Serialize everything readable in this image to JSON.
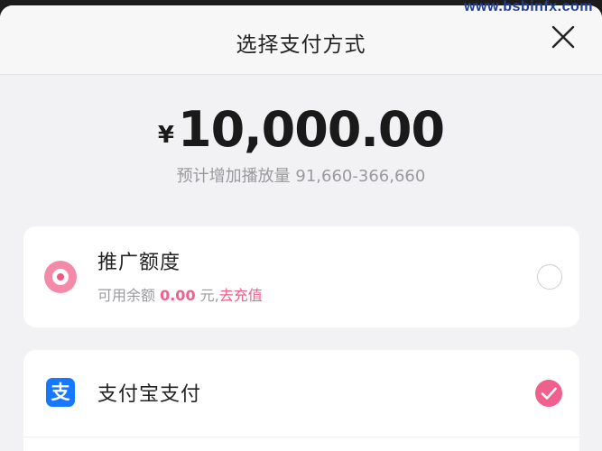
{
  "watermark": "www.bsbinfx.com",
  "header": {
    "title": "选择支付方式"
  },
  "amount": {
    "symbol": "¥",
    "value": "10,000.00"
  },
  "estimate": {
    "label": "预计增加播放量 91,660-366,660"
  },
  "payment_options": [
    {
      "title": "推广额度",
      "balance_prefix": "可用余额 ",
      "balance_value": "0.00",
      "balance_suffix": " 元,",
      "recharge_link": "去充值",
      "selected": false
    },
    {
      "title": "支付宝支付",
      "icon_glyph": "支",
      "selected": true
    }
  ],
  "colors": {
    "accent": "#f0608c",
    "alipay": "#1677ff",
    "sheet_bg": "#f2f2f4"
  }
}
